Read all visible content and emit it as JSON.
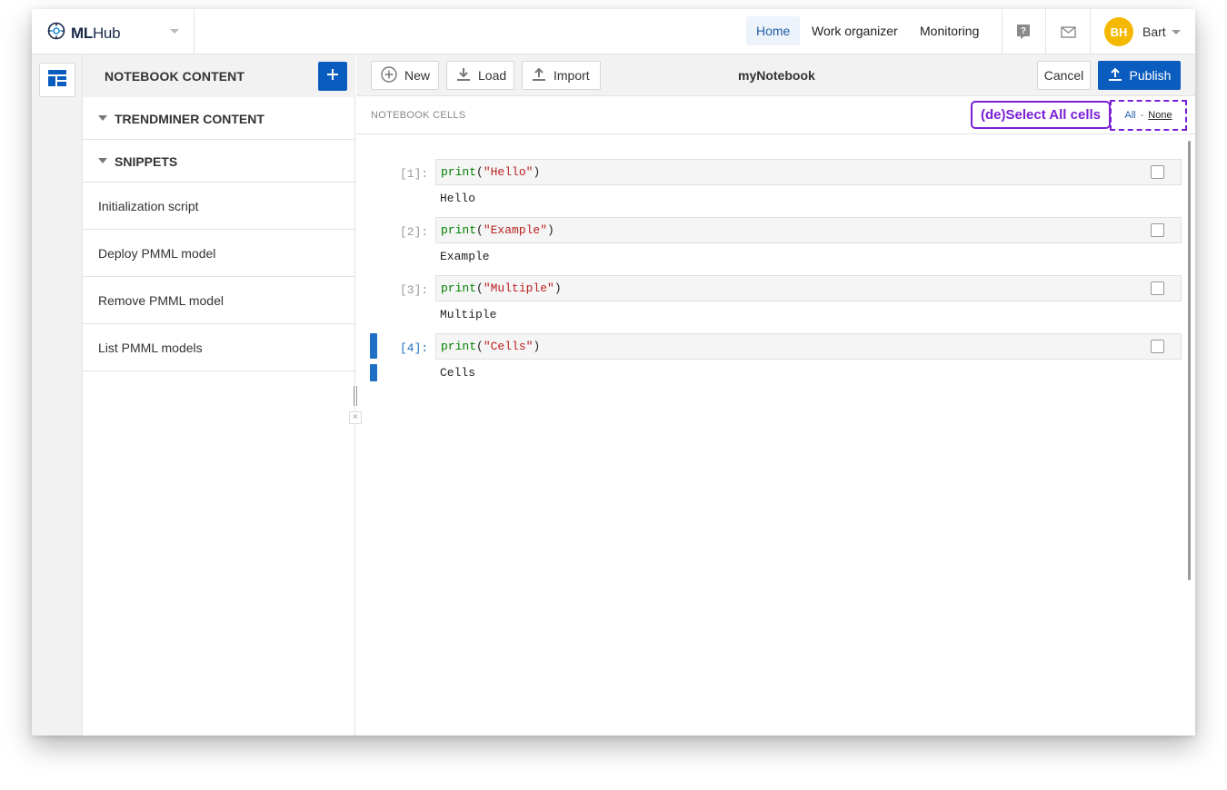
{
  "app": {
    "logo_text_ml": "ML",
    "logo_text_hub": "Hub"
  },
  "nav": {
    "home": "Home",
    "work_organizer": "Work organizer",
    "monitoring": "Monitoring",
    "user_initials": "BH",
    "user_name": "Bart"
  },
  "sidebar": {
    "title": "NOTEBOOK CONTENT",
    "sections": [
      "TRENDMINER CONTENT",
      "SNIPPETS"
    ],
    "snippets": [
      "Initialization script",
      "Deploy PMML model",
      "Remove PMML model",
      "List PMML models"
    ]
  },
  "toolbar": {
    "new_label": "New",
    "load_label": "Load",
    "import_label": "Import",
    "notebook_title": "myNotebook",
    "cancel_label": "Cancel",
    "publish_label": "Publish"
  },
  "cells_header": {
    "label": "NOTEBOOK CELLS",
    "callout": "(de)Select All cells",
    "all": "All",
    "separator": "-",
    "none": "None"
  },
  "cells": [
    {
      "prompt": "[1]:",
      "fn": "print",
      "open": "(",
      "str": "\"Hello\"",
      "close": ")",
      "output": "Hello",
      "selected": false,
      "active": false
    },
    {
      "prompt": "[2]:",
      "fn": "print",
      "open": "(",
      "str": "\"Example\"",
      "close": ")",
      "output": "Example",
      "selected": false,
      "active": false
    },
    {
      "prompt": "[3]:",
      "fn": "print",
      "open": "(",
      "str": "\"Multiple\"",
      "close": ")",
      "output": "Multiple",
      "selected": false,
      "active": false
    },
    {
      "prompt": "[4]:",
      "fn": "print",
      "open": "(",
      "str": "\"Cells\"",
      "close": ")",
      "output": "Cells",
      "selected": false,
      "active": true
    }
  ],
  "colors": {
    "primary": "#0b5cbf",
    "accent_callout": "#7a1fd6",
    "avatar": "#f5b800",
    "code_fn": "#008000",
    "code_string": "#ba2121"
  },
  "icons": {
    "logo": "brain-gear-icon",
    "help": "help-icon",
    "mail": "mail-icon",
    "rail": "layout-icon",
    "add": "plus-icon",
    "new": "plus-circle-icon",
    "load": "download-icon",
    "import": "upload-icon",
    "publish": "upload-icon"
  }
}
